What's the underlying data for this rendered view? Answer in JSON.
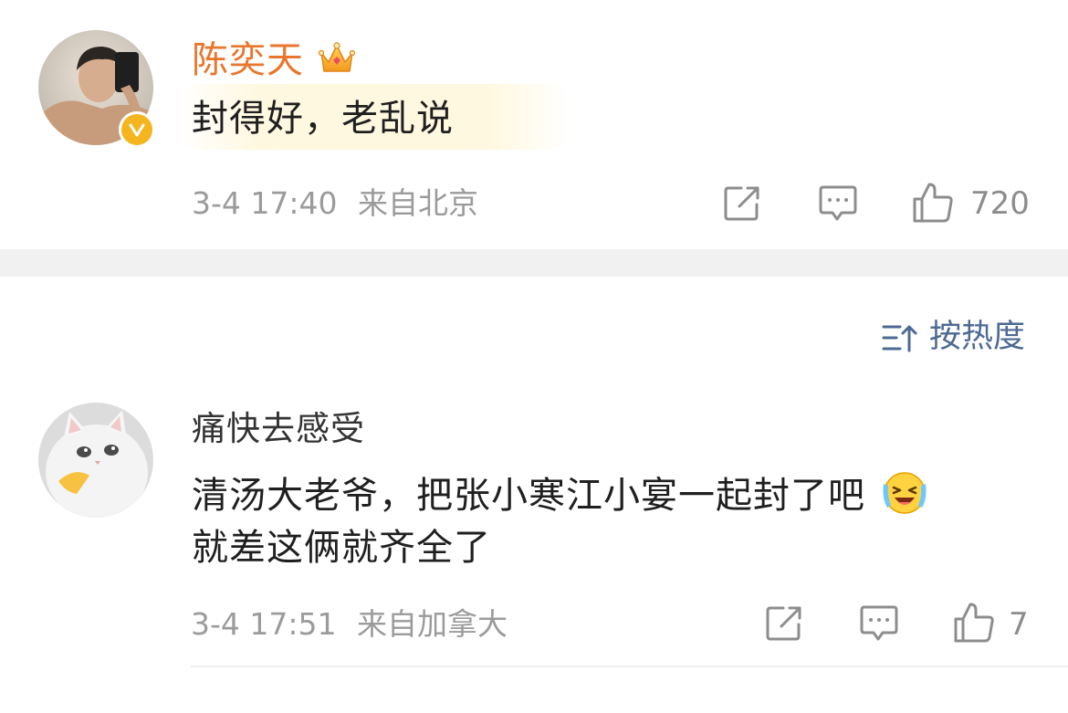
{
  "comments": [
    {
      "username": "陈奕天",
      "verified_badge": "V",
      "crown_icon": "crown-icon",
      "text_line_1": "封得好，老乱说",
      "timestamp": "3-4 17:40",
      "location": "来自北京",
      "like_count": "720",
      "name_color": "#e8762c"
    },
    {
      "username": "痛快去感受",
      "text_line_1": "清汤大老爷，把张小寒江小宴一起封了吧",
      "text_line_2": "就差这俩就齐全了",
      "emoji": "laugh-cry-emoji",
      "timestamp": "3-4 17:51",
      "location": "来自加拿大",
      "like_count": "7",
      "name_color": "#333333"
    }
  ],
  "sort": {
    "label": "按热度",
    "icon": "sort-icon",
    "color": "#4c6a93"
  }
}
